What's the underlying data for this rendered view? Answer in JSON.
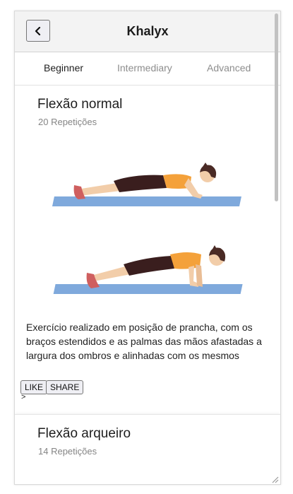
{
  "header": {
    "title": "Khalyx",
    "back_icon": "chevron-left-icon"
  },
  "tabs": [
    {
      "label": "Beginner",
      "active": true
    },
    {
      "label": "Intermediary",
      "active": false
    },
    {
      "label": "Advanced",
      "active": false
    }
  ],
  "exercises": [
    {
      "name": "Flexão normal",
      "reps": "20 Repetições",
      "description": "Exercício realizado em posição de prancha, com os braços estendidos e as palmas das mãos afastadas a largura dos ombros e alinhadas com os mesmos",
      "like_label": "LIKE",
      "share_label": "SHARE",
      "arrow_text": ">"
    },
    {
      "name": "Flexão arqueiro",
      "reps": "14 Repetições"
    }
  ],
  "colors": {
    "mat": "#7fa9dc",
    "skin": "#f2cda9",
    "pants": "#3a1e1e",
    "top": "#f4a13a",
    "shoes": "#cf5f5f",
    "hair": "#4a2a25"
  }
}
